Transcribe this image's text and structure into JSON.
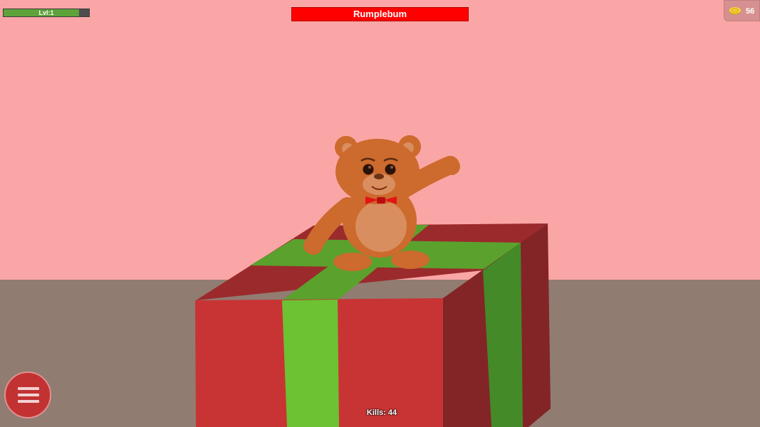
{
  "hud": {
    "level_label": "Lvl:1",
    "xp_fill_fraction": 0.88,
    "boss_name": "Rumplebum",
    "coins": "56",
    "kills_label": "Kills: 44"
  },
  "icons": {
    "coin": "coin-icon",
    "menu": "hamburger-menu-icon"
  },
  "colors": {
    "sky": "#fba6a6",
    "floor": "#917c72",
    "boss_bar": "#ff0000",
    "xp_fill": "#5ea33a",
    "menu_button": "#c23232"
  }
}
